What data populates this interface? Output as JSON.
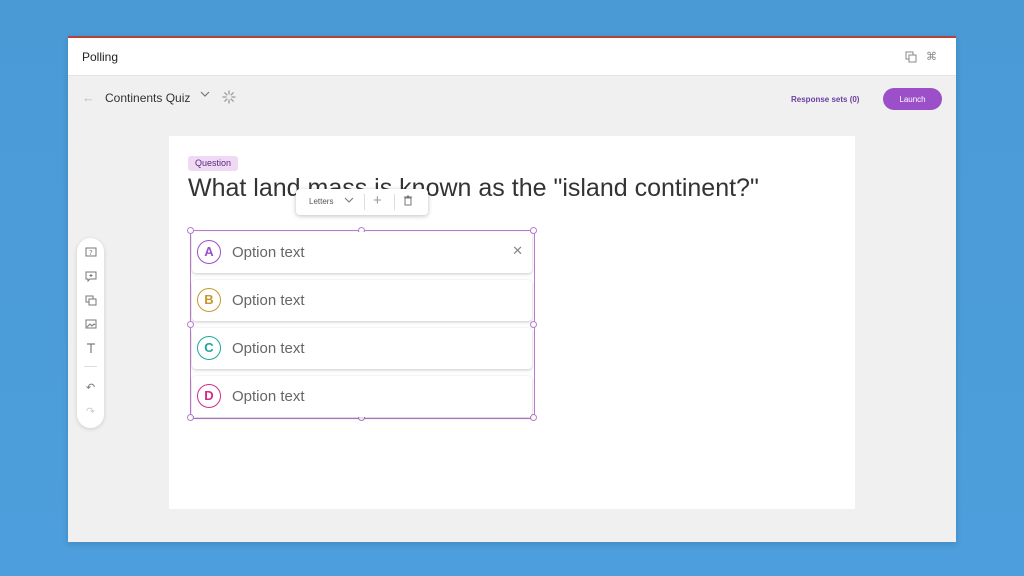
{
  "app": {
    "title": "Polling"
  },
  "toolbar": {
    "quiz_title": "Continents Quiz",
    "response_sets": "Response sets (0)",
    "launch_label": "Launch"
  },
  "question": {
    "badge": "Question",
    "text": "What land mass is known as the \"island continent?\""
  },
  "floating_toolbar": {
    "style_label": "Letters"
  },
  "options": [
    {
      "letter": "A",
      "text": "Option text",
      "color": "#9b4fc9"
    },
    {
      "letter": "B",
      "text": "Option text",
      "color": "#c9962b"
    },
    {
      "letter": "C",
      "text": "Option text",
      "color": "#1aa89b"
    },
    {
      "letter": "D",
      "text": "Option text",
      "color": "#d02b8a"
    }
  ],
  "colors": {
    "accent": "#9b4fc9",
    "badge_bg": "#efd9f5",
    "selection": "#b97bd1"
  },
  "icons": [
    "copy-icon",
    "command-icon",
    "back-arrow-icon",
    "chevron-down-icon",
    "loading-spinner-icon",
    "plus-icon",
    "trash-icon",
    "close-icon",
    "add-question-icon",
    "add-comment-icon",
    "add-slide-icon",
    "add-image-icon",
    "text-icon",
    "undo-icon",
    "redo-icon"
  ]
}
